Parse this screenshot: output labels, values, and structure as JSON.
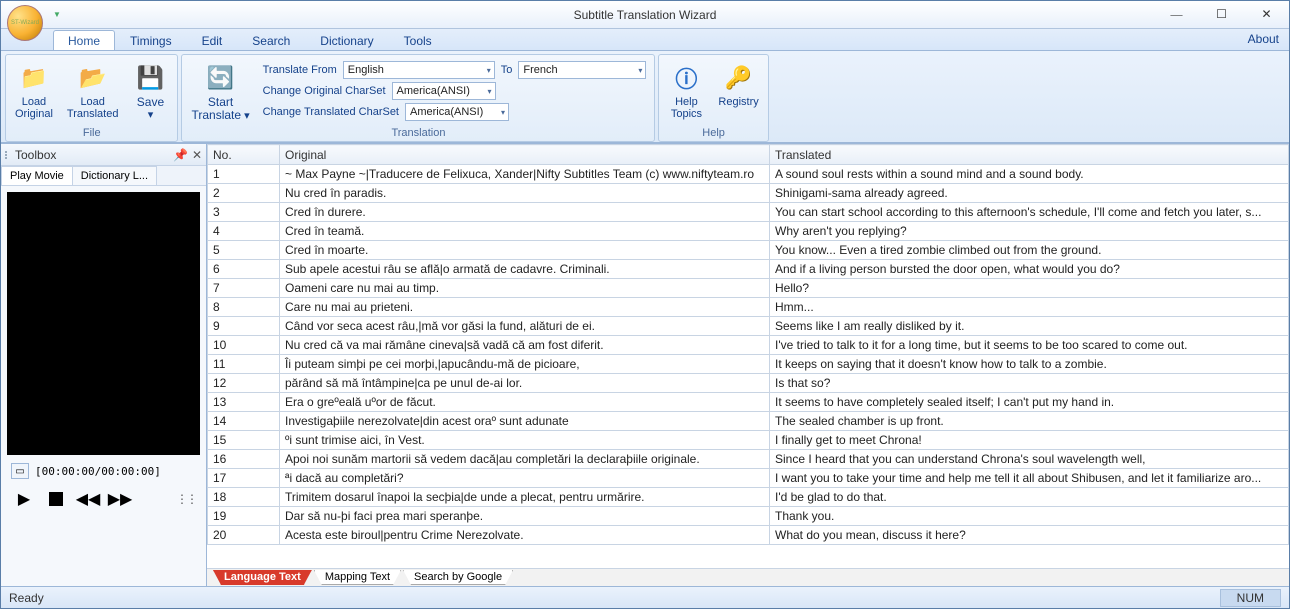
{
  "app": {
    "title": "Subtitle Translation Wizard",
    "about": "About"
  },
  "menu": {
    "tabs": [
      "Home",
      "Timings",
      "Edit",
      "Search",
      "Dictionary",
      "Tools"
    ],
    "active": 0
  },
  "ribbon": {
    "file": {
      "group": "File",
      "loadOriginal": "Load\nOriginal",
      "loadTranslated": "Load\nTranslated",
      "save": "Save"
    },
    "translation": {
      "group": "Translation",
      "start": "Start\nTranslate",
      "fromLabel": "Translate From",
      "fromVal": "English",
      "toLabel": "To",
      "toVal": "French",
      "origCSLabel": "Change Original CharSet",
      "origCSVal": "America(ANSI)",
      "trCSLabel": "Change Translated CharSet",
      "trCSVal": "America(ANSI)"
    },
    "help": {
      "group": "Help",
      "topics": "Help\nTopics",
      "registry": "Registry"
    }
  },
  "sidebar": {
    "title": "Toolbox",
    "tabs": [
      "Play Movie",
      "Dictionary L..."
    ],
    "timecode": "[00:00:00/00:00:00]"
  },
  "grid": {
    "cols": {
      "no": "No.",
      "orig": "Original",
      "tr": "Translated"
    },
    "rows": [
      {
        "n": "1",
        "o": "~ Max Payne ~|Traducere de Felixuca, Xander|Nifty Subtitles Team (c) www.niftyteam.ro",
        "t": "A sound soul rests within a sound mind and a sound body."
      },
      {
        "n": "2",
        "o": "Nu cred în paradis.",
        "t": "Shinigami-sama already agreed."
      },
      {
        "n": "3",
        "o": "Cred în durere.",
        "t": "You can start school according to this afternoon's schedule, I'll come and fetch you later, s..."
      },
      {
        "n": "4",
        "o": "Cred în teamă.",
        "t": "Why aren't you replying?"
      },
      {
        "n": "5",
        "o": "Cred în moarte.",
        "t": "You know... Even a tired zombie climbed out from the ground."
      },
      {
        "n": "6",
        "o": "Sub apele acestui râu se află|o armată de cadavre. Criminali.",
        "t": "And if a living person bursted the door open, what would you do?"
      },
      {
        "n": "7",
        "o": "Oameni care nu mai au timp.",
        "t": "Hello?"
      },
      {
        "n": "8",
        "o": "Care nu mai au prieteni.",
        "t": "Hmm..."
      },
      {
        "n": "9",
        "o": "Când vor seca acest râu,|mă vor găsi la fund, alături de ei.",
        "t": "Seems like I am really disliked by it."
      },
      {
        "n": "10",
        "o": "Nu cred că va mai rămâne cineva|să vadă că am fost diferit.",
        "t": "I've tried to talk to it for a long time, but it seems to be too scared to come out."
      },
      {
        "n": "11",
        "o": "Îi puteam simþi pe cei morþi,|apucându-mă de picioare,",
        "t": "It keeps on saying that it doesn't know how to talk to a zombie."
      },
      {
        "n": "12",
        "o": "părând să mă întâmpine|ca pe unul de-ai lor.",
        "t": "Is that so?"
      },
      {
        "n": "13",
        "o": "Era o greºeală uºor de făcut.",
        "t": "It seems to have completely sealed itself; I can't put my hand in."
      },
      {
        "n": "14",
        "o": "Investigaþiile nerezolvate|din acest oraº sunt adunate",
        "t": "The sealed chamber is up front."
      },
      {
        "n": "15",
        "o": "ºi sunt trimise aici, în Vest.",
        "t": "I finally get to meet Chrona!"
      },
      {
        "n": "16",
        "o": "Apoi noi sunăm martorii să vedem dacă|au completări la declaraþiile originale.",
        "t": "Since I heard that you can understand Chrona's soul wavelength well,"
      },
      {
        "n": "17",
        "o": "ªi dacă au completări?",
        "t": "I want you to take your time and help me tell it all about Shibusen, and let it familiarize aro..."
      },
      {
        "n": "18",
        "o": "Trimitem dosarul înapoi la secþia|de unde a plecat, pentru urmărire.",
        "t": "I'd be glad to do that."
      },
      {
        "n": "19",
        "o": "Dar să nu-þi faci prea mari speranþe.",
        "t": "Thank you."
      },
      {
        "n": "20",
        "o": "Acesta este biroul|pentru Crime Nerezolvate.",
        "t": "What do you mean, discuss it here?"
      }
    ]
  },
  "bottomTabs": [
    "Language Text",
    "Mapping Text",
    "Search by Google"
  ],
  "status": {
    "ready": "Ready",
    "num": "NUM"
  }
}
